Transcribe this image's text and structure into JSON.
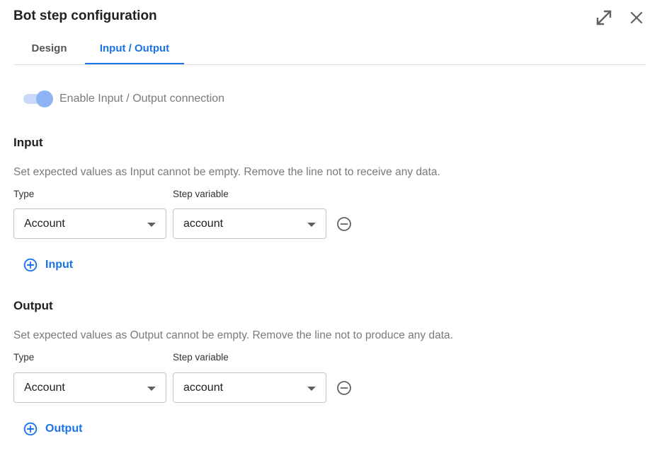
{
  "dialog": {
    "title": "Bot step configuration"
  },
  "tabs": [
    {
      "label": "Design",
      "active": false
    },
    {
      "label": "Input / Output",
      "active": true
    }
  ],
  "toggle": {
    "label": "Enable Input / Output connection",
    "enabled": true
  },
  "input_section": {
    "title": "Input",
    "help": "Set expected values as Input cannot be empty. Remove the line not to receive any data.",
    "type_label": "Type",
    "variable_label": "Step variable",
    "rows": [
      {
        "type": "Account",
        "variable": "account"
      }
    ],
    "add_label": "Input"
  },
  "output_section": {
    "title": "Output",
    "help": "Set expected values as Output cannot be empty. Remove the line not to produce any data.",
    "type_label": "Type",
    "variable_label": "Step variable",
    "rows": [
      {
        "type": "Account",
        "variable": "account"
      }
    ],
    "add_label": "Output"
  },
  "colors": {
    "accent": "#1a73e8",
    "toggle_track": "#c8daf8",
    "toggle_thumb": "#8fb4f3",
    "muted_text": "#7a7a7a"
  },
  "icons": {
    "expand": "expand-diagonal-icon",
    "close": "close-icon",
    "dropdown": "caret-down-icon",
    "remove": "minus-circle-icon",
    "add": "plus-circle-icon"
  }
}
